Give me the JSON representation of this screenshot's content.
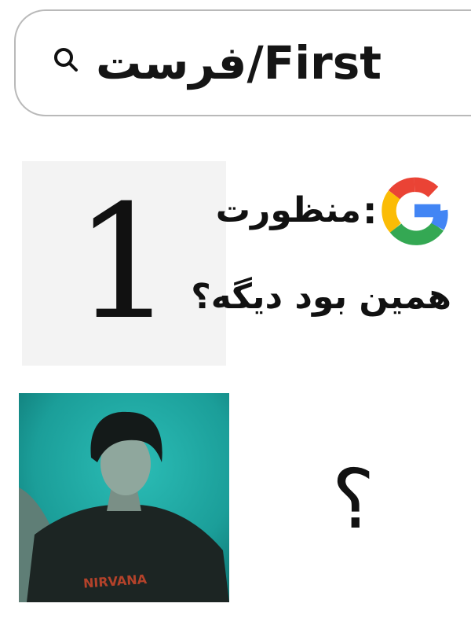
{
  "search": {
    "query": "فرست/First",
    "icon": "search-icon"
  },
  "left_card": {
    "number": "1"
  },
  "google_reply": {
    "logo": "google-g-logo",
    "colon": ":",
    "line1": "منظورت",
    "line2": "همین بود دیگه؟"
  },
  "photo": {
    "description_icon": "portrait-photo",
    "shirt_text": "NIRVANA"
  },
  "answer": {
    "mark": "؟"
  },
  "colors": {
    "photo_bg": "#1fa7a1",
    "google_blue": "#4285F4",
    "google_red": "#EA4335",
    "google_yellow": "#FBBC05",
    "google_green": "#34A853"
  }
}
